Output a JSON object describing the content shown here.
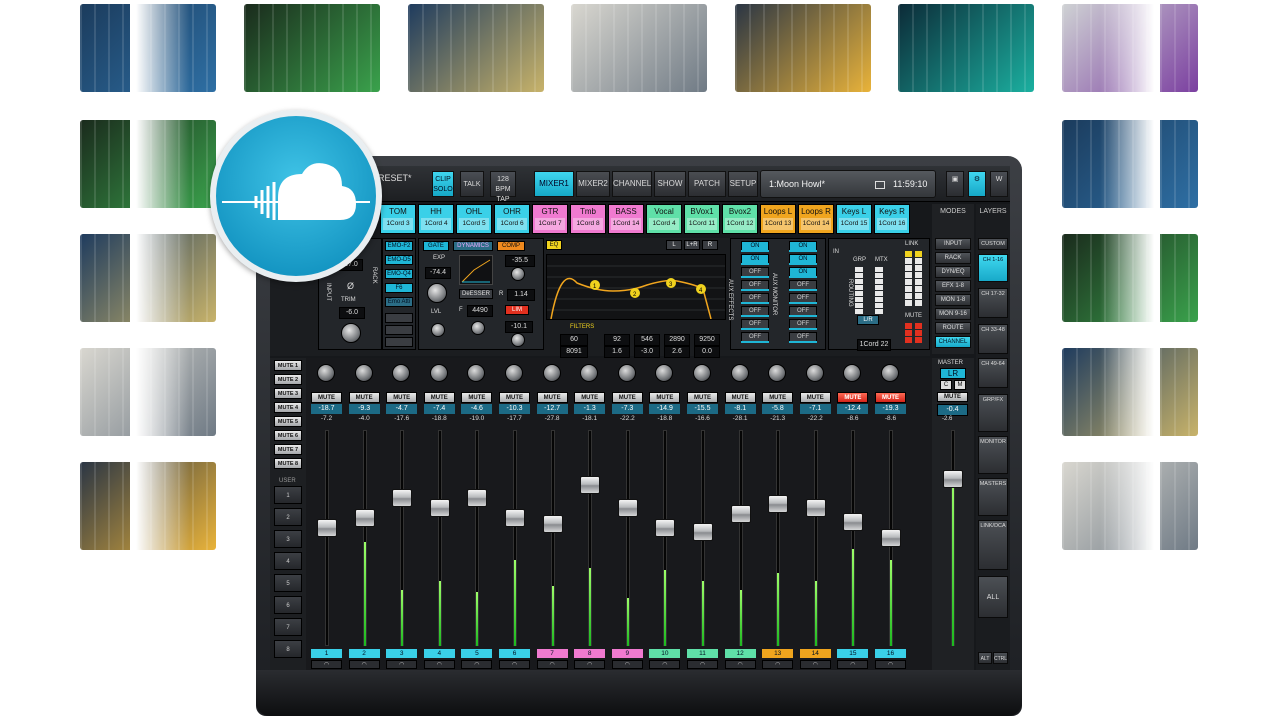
{
  "topbar": {
    "preset": "RESET*",
    "clip_solo": "CLIP SOLO",
    "talk": "TALK",
    "tempo": "128 BPM",
    "tap": "TAP",
    "tabs": [
      "MIXER1",
      "MIXER2",
      "CHANNEL",
      "SHOW",
      "PATCH",
      "SETUP"
    ],
    "active_tab": "MIXER1",
    "song": "1:Moon Howl*",
    "time": "11:59:10"
  },
  "channel_names": [
    {
      "name": "TOM",
      "input": "1Cord 3",
      "color": "#3ad0e8"
    },
    {
      "name": "HH",
      "input": "1Cord 4",
      "color": "#3ad0e8"
    },
    {
      "name": "OHL",
      "input": "1Cord 5",
      "color": "#3ad0e8"
    },
    {
      "name": "OHR",
      "input": "1Cord 6",
      "color": "#3ad0e8"
    },
    {
      "name": "GTR",
      "input": "1Cord 7",
      "color": "#f07ad0"
    },
    {
      "name": "Tmb",
      "input": "1Cord 8",
      "color": "#f07ad0"
    },
    {
      "name": "BASS",
      "input": "1Cord 14",
      "color": "#f07ad0"
    },
    {
      "name": "Vocal",
      "input": "1Cord 4",
      "color": "#5fe0a8"
    },
    {
      "name": "BVox1",
      "input": "1Cord 11",
      "color": "#5fe0a8"
    },
    {
      "name": "Bvox2",
      "input": "1Cord 12",
      "color": "#5fe0a8"
    },
    {
      "name": "Loops L",
      "input": "1Cord 13",
      "color": "#f0a51e"
    },
    {
      "name": "Loops R",
      "input": "1Cord 14",
      "color": "#f0a51e"
    },
    {
      "name": "Keys L",
      "input": "1Cord 15",
      "color": "#3ad0e8"
    },
    {
      "name": "Keys R",
      "input": "1Cord 16",
      "color": "#3ad0e8"
    }
  ],
  "modes": {
    "title": "MODES",
    "items": [
      "INPUT",
      "RACK",
      "DYN/EQ",
      "EFX 1-8",
      "MON 1-8",
      "MON 9-16",
      "ROUTE",
      "CHANNEL"
    ],
    "active": "CHANNEL"
  },
  "layers": {
    "title": "LAYERS",
    "items": [
      "CUSTOM",
      "CH 1-16",
      "CH 17-32",
      "CH 33-48",
      "CH 49-64",
      "GRP/FX",
      "MONITOR",
      "MASTERS",
      "LINK/DCA",
      "ALL"
    ],
    "active": "CH 1-16",
    "alt": "ALT",
    "ctrl": "CTRL"
  },
  "processing": {
    "emo_slots": [
      "EMO-F2",
      "EMO-D5",
      "EMO-Q4",
      "F6",
      "Emo Atti"
    ],
    "gain_value": "27.0",
    "phase_label": "Ø",
    "trim_label": "TRIM",
    "trim_value": "-6.0",
    "input_label": "INPUT",
    "rack_label": "RACK",
    "dynamic_label": "DYNAMIC",
    "gate_label": "GATE",
    "dynamics_label": "DYNAMICS",
    "comp_label": "COMP",
    "exp_label": "EXP",
    "gate_value": "-74.4",
    "lvl_label": "LVL",
    "comp_value": "-35.5",
    "deesser_label": "DeESSER",
    "deesser_f": "4490",
    "ratio_value": "1.14",
    "lim_label": "LIM",
    "comp_out": "-10.1",
    "eq_label": "EQ",
    "eq_buttons": [
      "L",
      "L+R",
      "R"
    ],
    "filters_label": "FILTERS",
    "filter_values": [
      "60",
      "8091"
    ],
    "bands": [
      {
        "freq": "92",
        "gain": "1.6"
      },
      {
        "freq": "546",
        "gain": "-3.0"
      },
      {
        "freq": "2890",
        "gain": "2.6"
      },
      {
        "freq": "9250",
        "gain": "0.0"
      }
    ],
    "aux_effects": "AUX EFFECTS",
    "aux_monitor": "AUX MONITOR",
    "routing_label": "ROUTING",
    "in_label": "IN",
    "grp_label": "GRP",
    "mtx_label": "MTX",
    "link_label": "LINK",
    "mute_label": "MUTE",
    "lr_label": "L/R",
    "cord": "1Cord 22"
  },
  "mute_groups": [
    "MUTE 1",
    "MUTE 2",
    "MUTE 3",
    "MUTE 4",
    "MUTE 5",
    "MUTE 6",
    "MUTE 7",
    "MUTE 8"
  ],
  "user_label": "USER",
  "user_buttons": [
    "1",
    "2",
    "3",
    "4",
    "5",
    "6",
    "7",
    "8"
  ],
  "channels": [
    {
      "num": "1",
      "gain": "-18.7",
      "trim": "-7.2",
      "mute": false,
      "level": 0.55,
      "meter": 0.0,
      "color": "#3ad0e8"
    },
    {
      "num": "2",
      "gain": "-9.3",
      "trim": "-4.0",
      "mute": false,
      "level": 0.6,
      "meter": 0.48,
      "color": "#3ad0e8"
    },
    {
      "num": "3",
      "gain": "-4.7",
      "trim": "-17.6",
      "mute": false,
      "level": 0.7,
      "meter": 0.26,
      "color": "#3ad0e8"
    },
    {
      "num": "4",
      "gain": "-7.4",
      "trim": "-18.8",
      "mute": false,
      "level": 0.65,
      "meter": 0.3,
      "color": "#3ad0e8"
    },
    {
      "num": "5",
      "gain": "-4.6",
      "trim": "-19.0",
      "mute": false,
      "level": 0.7,
      "meter": 0.25,
      "color": "#3ad0e8"
    },
    {
      "num": "6",
      "gain": "-10.3",
      "trim": "-17.7",
      "mute": false,
      "level": 0.6,
      "meter": 0.4,
      "color": "#3ad0e8"
    },
    {
      "num": "7",
      "gain": "-12.7",
      "trim": "-27.8",
      "mute": false,
      "level": 0.57,
      "meter": 0.28,
      "color": "#f07ad0"
    },
    {
      "num": "8",
      "gain": "-1.3",
      "trim": "-18.1",
      "mute": false,
      "level": 0.77,
      "meter": 0.36,
      "color": "#f07ad0"
    },
    {
      "num": "9",
      "gain": "-7.3",
      "trim": "-22.2",
      "mute": false,
      "level": 0.65,
      "meter": 0.22,
      "color": "#f07ad0"
    },
    {
      "num": "10",
      "gain": "-14.9",
      "trim": "-18.8",
      "mute": false,
      "level": 0.55,
      "meter": 0.35,
      "color": "#5fe0a8"
    },
    {
      "num": "11",
      "gain": "-15.5",
      "trim": "-16.6",
      "mute": false,
      "level": 0.53,
      "meter": 0.3,
      "color": "#5fe0a8"
    },
    {
      "num": "12",
      "gain": "-8.1",
      "trim": "-28.1",
      "mute": false,
      "level": 0.62,
      "meter": 0.26,
      "color": "#5fe0a8"
    },
    {
      "num": "13",
      "gain": "-5.8",
      "trim": "-21.3",
      "mute": false,
      "level": 0.67,
      "meter": 0.34,
      "color": "#f0a51e"
    },
    {
      "num": "14",
      "gain": "-7.1",
      "trim": "-22.2",
      "mute": false,
      "level": 0.65,
      "meter": 0.3,
      "color": "#f0a51e"
    },
    {
      "num": "15",
      "gain": "-12.4",
      "trim": "-8.6",
      "mute": true,
      "level": 0.58,
      "meter": 0.45,
      "color": "#3ad0e8"
    },
    {
      "num": "16",
      "gain": "-19.3",
      "trim": "-8.6",
      "mute": true,
      "level": 0.5,
      "meter": 0.4,
      "color": "#3ad0e8"
    }
  ],
  "mute_label": "MUTE",
  "master": {
    "label": "MASTER",
    "bus": "LR",
    "c": "C",
    "m": "M",
    "mute": "MUTE",
    "gain": "-0.4",
    "trim": "-2.6",
    "level": 0.8,
    "meter": 0.78
  },
  "fader_scale": [
    "10",
    "5",
    "0",
    "5",
    "10",
    "20",
    "30",
    "40",
    "50",
    "60"
  ],
  "colors": {
    "accent": "#1fb6d6",
    "mute_on": "#e2301f",
    "meter": "#2fd12c",
    "background": "#ffffff"
  },
  "thumbnails": [
    "plugin-thumb-eq",
    "plugin-thumb-mixer",
    "plugin-thumb-compressor",
    "plugin-thumb-channel-strip",
    "plugin-thumb-fader",
    "plugin-thumb-waveform",
    "plugin-thumb-xover"
  ]
}
